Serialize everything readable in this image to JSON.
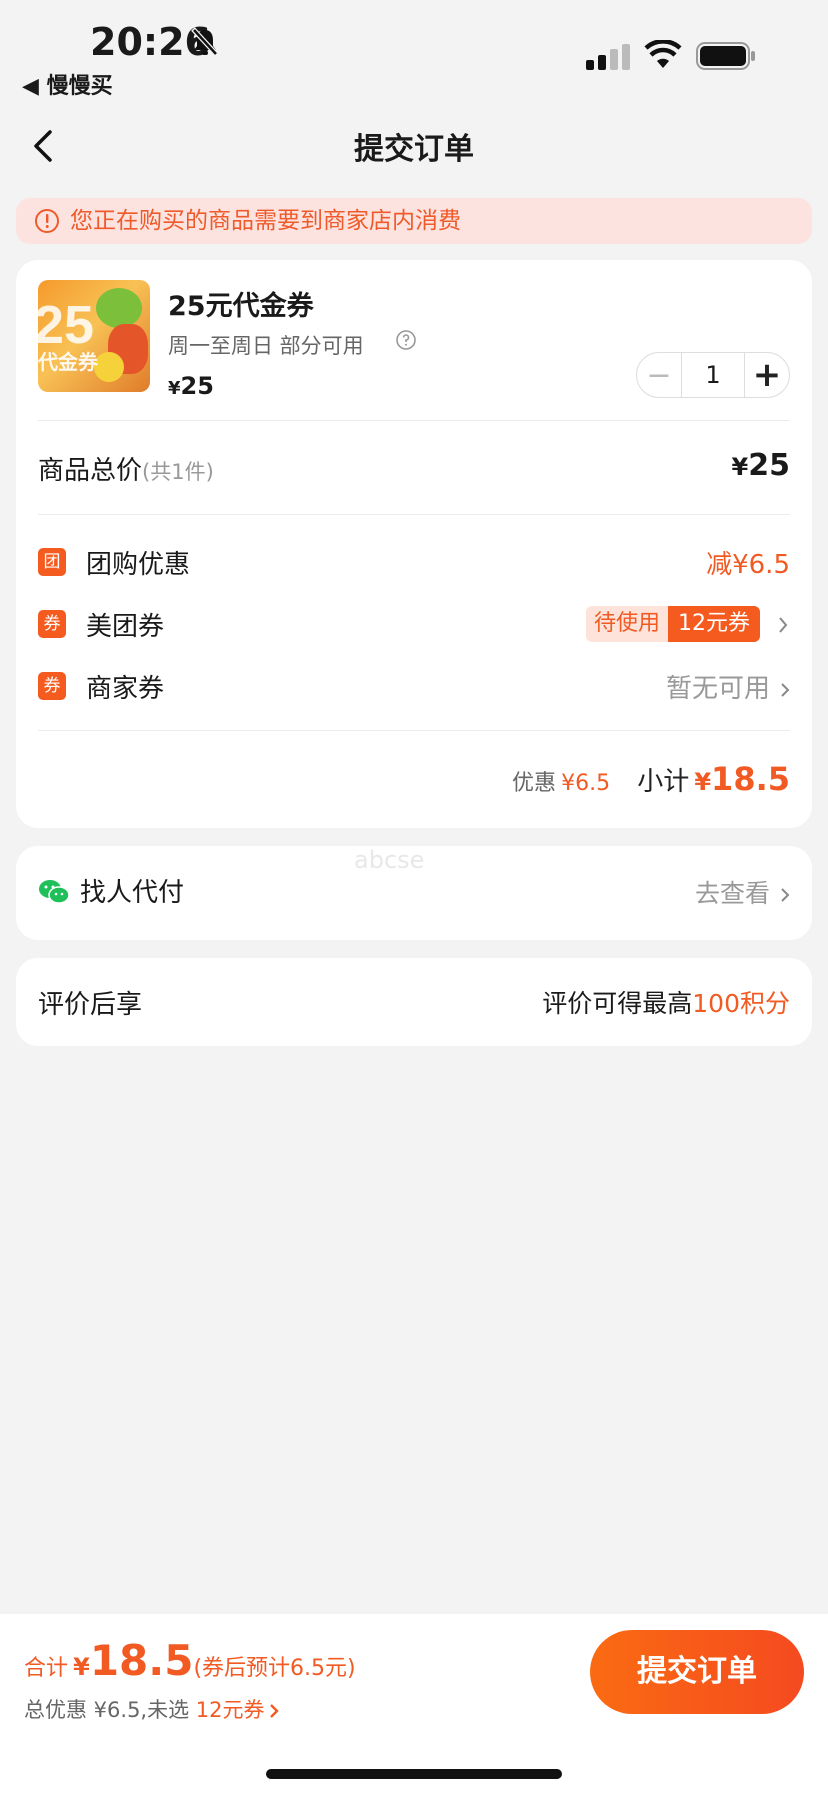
{
  "status_bar": {
    "time": "20:26",
    "back_app": "◀ 慢慢买"
  },
  "nav": {
    "title": "提交订单"
  },
  "notice": {
    "text": "您正在购买的商品需要到商家店内消费"
  },
  "product": {
    "image_text_big": "25",
    "image_text_small": "代金券",
    "name": "25元代金券",
    "subtitle": "周一至周日 部分可用",
    "price_symbol": "¥",
    "price": "25",
    "quantity": "1"
  },
  "summary": {
    "total_label": "商品总价",
    "total_count": "(共1件)",
    "total_symbol": "¥",
    "total_value": "25"
  },
  "discounts": [
    {
      "badge": "团",
      "label": "团购优惠",
      "value": "减¥6.5"
    },
    {
      "badge": "券",
      "label": "美团券",
      "tag_status": "待使用",
      "tag_amount": "12元券"
    },
    {
      "badge": "券",
      "label": "商家券",
      "value": "暂无可用"
    }
  ],
  "subtotal": {
    "discount_label": "优惠",
    "discount_value": "¥6.5",
    "label": "小计",
    "symbol": "¥",
    "value": "18.5"
  },
  "pay_for_me": {
    "label": "找人代付",
    "link": "去查看",
    "watermark": "abcse"
  },
  "review": {
    "label": "评价后享",
    "prefix": "评价可得最高",
    "value": "100积分"
  },
  "bottom": {
    "total_label": "合计",
    "symbol": "¥",
    "amount": "18.5",
    "after_coupon": "(券后预计6.5元)",
    "discount_line_prefix": "总优惠 ¥6.5,未选",
    "discount_line_coupon": "12元券",
    "submit_label": "提交订单"
  },
  "colors": {
    "accent": "#f25a24",
    "button": "#f55a1f",
    "notice_bg": "#fde3df"
  },
  "icons": [
    "bell-slash-icon",
    "signal-icon",
    "wifi-icon",
    "battery-icon",
    "back-arrow-icon",
    "alert-circle-icon",
    "help-circle-icon",
    "chevron-right-icon",
    "wechat-icon"
  ]
}
